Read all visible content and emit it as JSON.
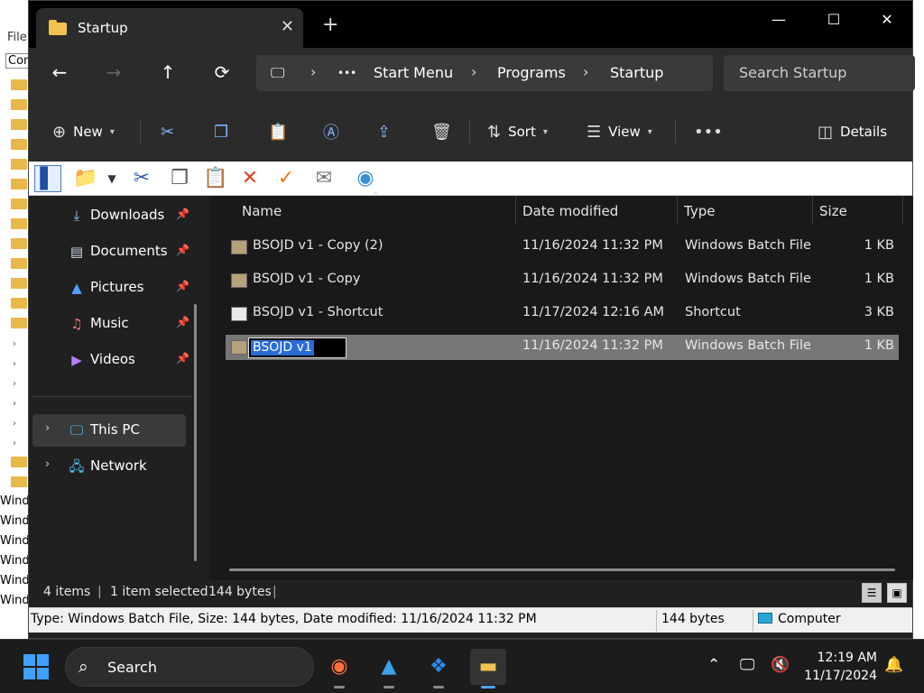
{
  "background_app": {
    "menu_label": "File",
    "con_label": "Con",
    "win_labels": [
      "Wind",
      "Wind",
      "Wind",
      "Wind",
      "Wind",
      "Wind"
    ]
  },
  "window": {
    "tab_title": "Startup",
    "new_tab_symbol": "+",
    "minimize_symbol": "—",
    "maximize_symbol": "☐",
    "close_symbol": "✕"
  },
  "address": {
    "more_symbol": "•••",
    "crumbs": [
      "Start Menu",
      "Programs",
      "Startup"
    ],
    "search_placeholder": "Search Startup"
  },
  "commandbar": {
    "new_label": "New",
    "sort_label": "Sort",
    "view_label": "View",
    "more_symbol": "•••",
    "details_label": "Details"
  },
  "navpane": {
    "quick_access": [
      {
        "label": "Downloads",
        "icon": "download-icon"
      },
      {
        "label": "Documents",
        "icon": "documents-icon"
      },
      {
        "label": "Pictures",
        "icon": "pictures-icon"
      },
      {
        "label": "Music",
        "icon": "music-icon"
      },
      {
        "label": "Videos",
        "icon": "videos-icon"
      }
    ],
    "this_pc": "This PC",
    "network": "Network"
  },
  "columns": {
    "name": "Name",
    "date": "Date modified",
    "type": "Type",
    "size": "Size"
  },
  "files": [
    {
      "name": "BSOJD v1 - Copy (2)",
      "date": "11/16/2024 11:32 PM",
      "type": "Windows Batch File",
      "size": "1 KB"
    },
    {
      "name": "BSOJD v1 - Copy",
      "date": "11/16/2024 11:32 PM",
      "type": "Windows Batch File",
      "size": "1 KB"
    },
    {
      "name": "BSOJD v1 - Shortcut",
      "date": "11/17/2024 12:16 AM",
      "type": "Shortcut",
      "size": "3 KB"
    },
    {
      "name": "BSOJD v1",
      "date": "11/16/2024 11:32 PM",
      "type": "Windows Batch File",
      "size": "1 KB",
      "selected": true,
      "renaming": true
    }
  ],
  "status": {
    "items": "4 items",
    "selected": "1 item selected",
    "bytes": "144 bytes"
  },
  "infobar": {
    "details": "Type: Windows Batch File, Size: 144 bytes, Date modified: 11/16/2024 11:32 PM",
    "size": "144 bytes",
    "location": "Computer"
  },
  "taskbar": {
    "search_label": "Search",
    "time": "12:19 AM",
    "date": "11/17/2024"
  },
  "colors": {
    "accent": "#2a6bd6",
    "folder": "#f2c14e",
    "start": "#3ea0ff"
  }
}
